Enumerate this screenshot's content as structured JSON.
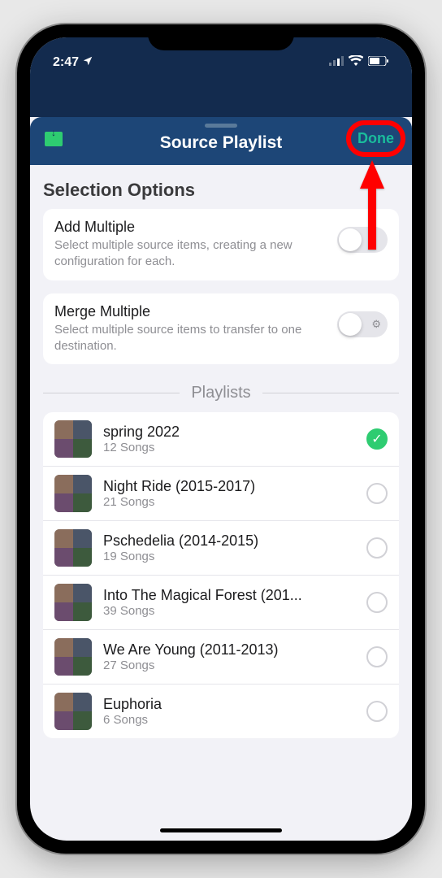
{
  "status": {
    "time": "2:47",
    "location_icon": "location-icon",
    "signal": "signal-icon",
    "wifi": "wifi-icon",
    "battery": "battery-icon"
  },
  "header": {
    "title": "Source Playlist",
    "done_label": "Done",
    "left_icon": "download-tray-icon"
  },
  "selection": {
    "section_title": "Selection Options",
    "options": [
      {
        "title": "Add Multiple",
        "desc": "Select multiple source items, creating a new configuration for each.",
        "on": false
      },
      {
        "title": "Merge Multiple",
        "desc": "Select multiple source items to transfer to one destination.",
        "on": false
      }
    ]
  },
  "playlists": {
    "section_title": "Playlists",
    "items": [
      {
        "name": "spring 2022",
        "meta": "12 Songs",
        "selected": true
      },
      {
        "name": "Night Ride (2015-2017)",
        "meta": "21 Songs",
        "selected": false
      },
      {
        "name": "Pschedelia (2014-2015)",
        "meta": "19 Songs",
        "selected": false
      },
      {
        "name": "Into The Magical Forest (201...",
        "meta": "39 Songs",
        "selected": false
      },
      {
        "name": "We Are Young (2011-2013)",
        "meta": "27 Songs",
        "selected": false
      },
      {
        "name": "Euphoria",
        "meta": "6 Songs",
        "selected": false
      }
    ]
  },
  "annotation": {
    "highlight_color": "#ff0000"
  }
}
